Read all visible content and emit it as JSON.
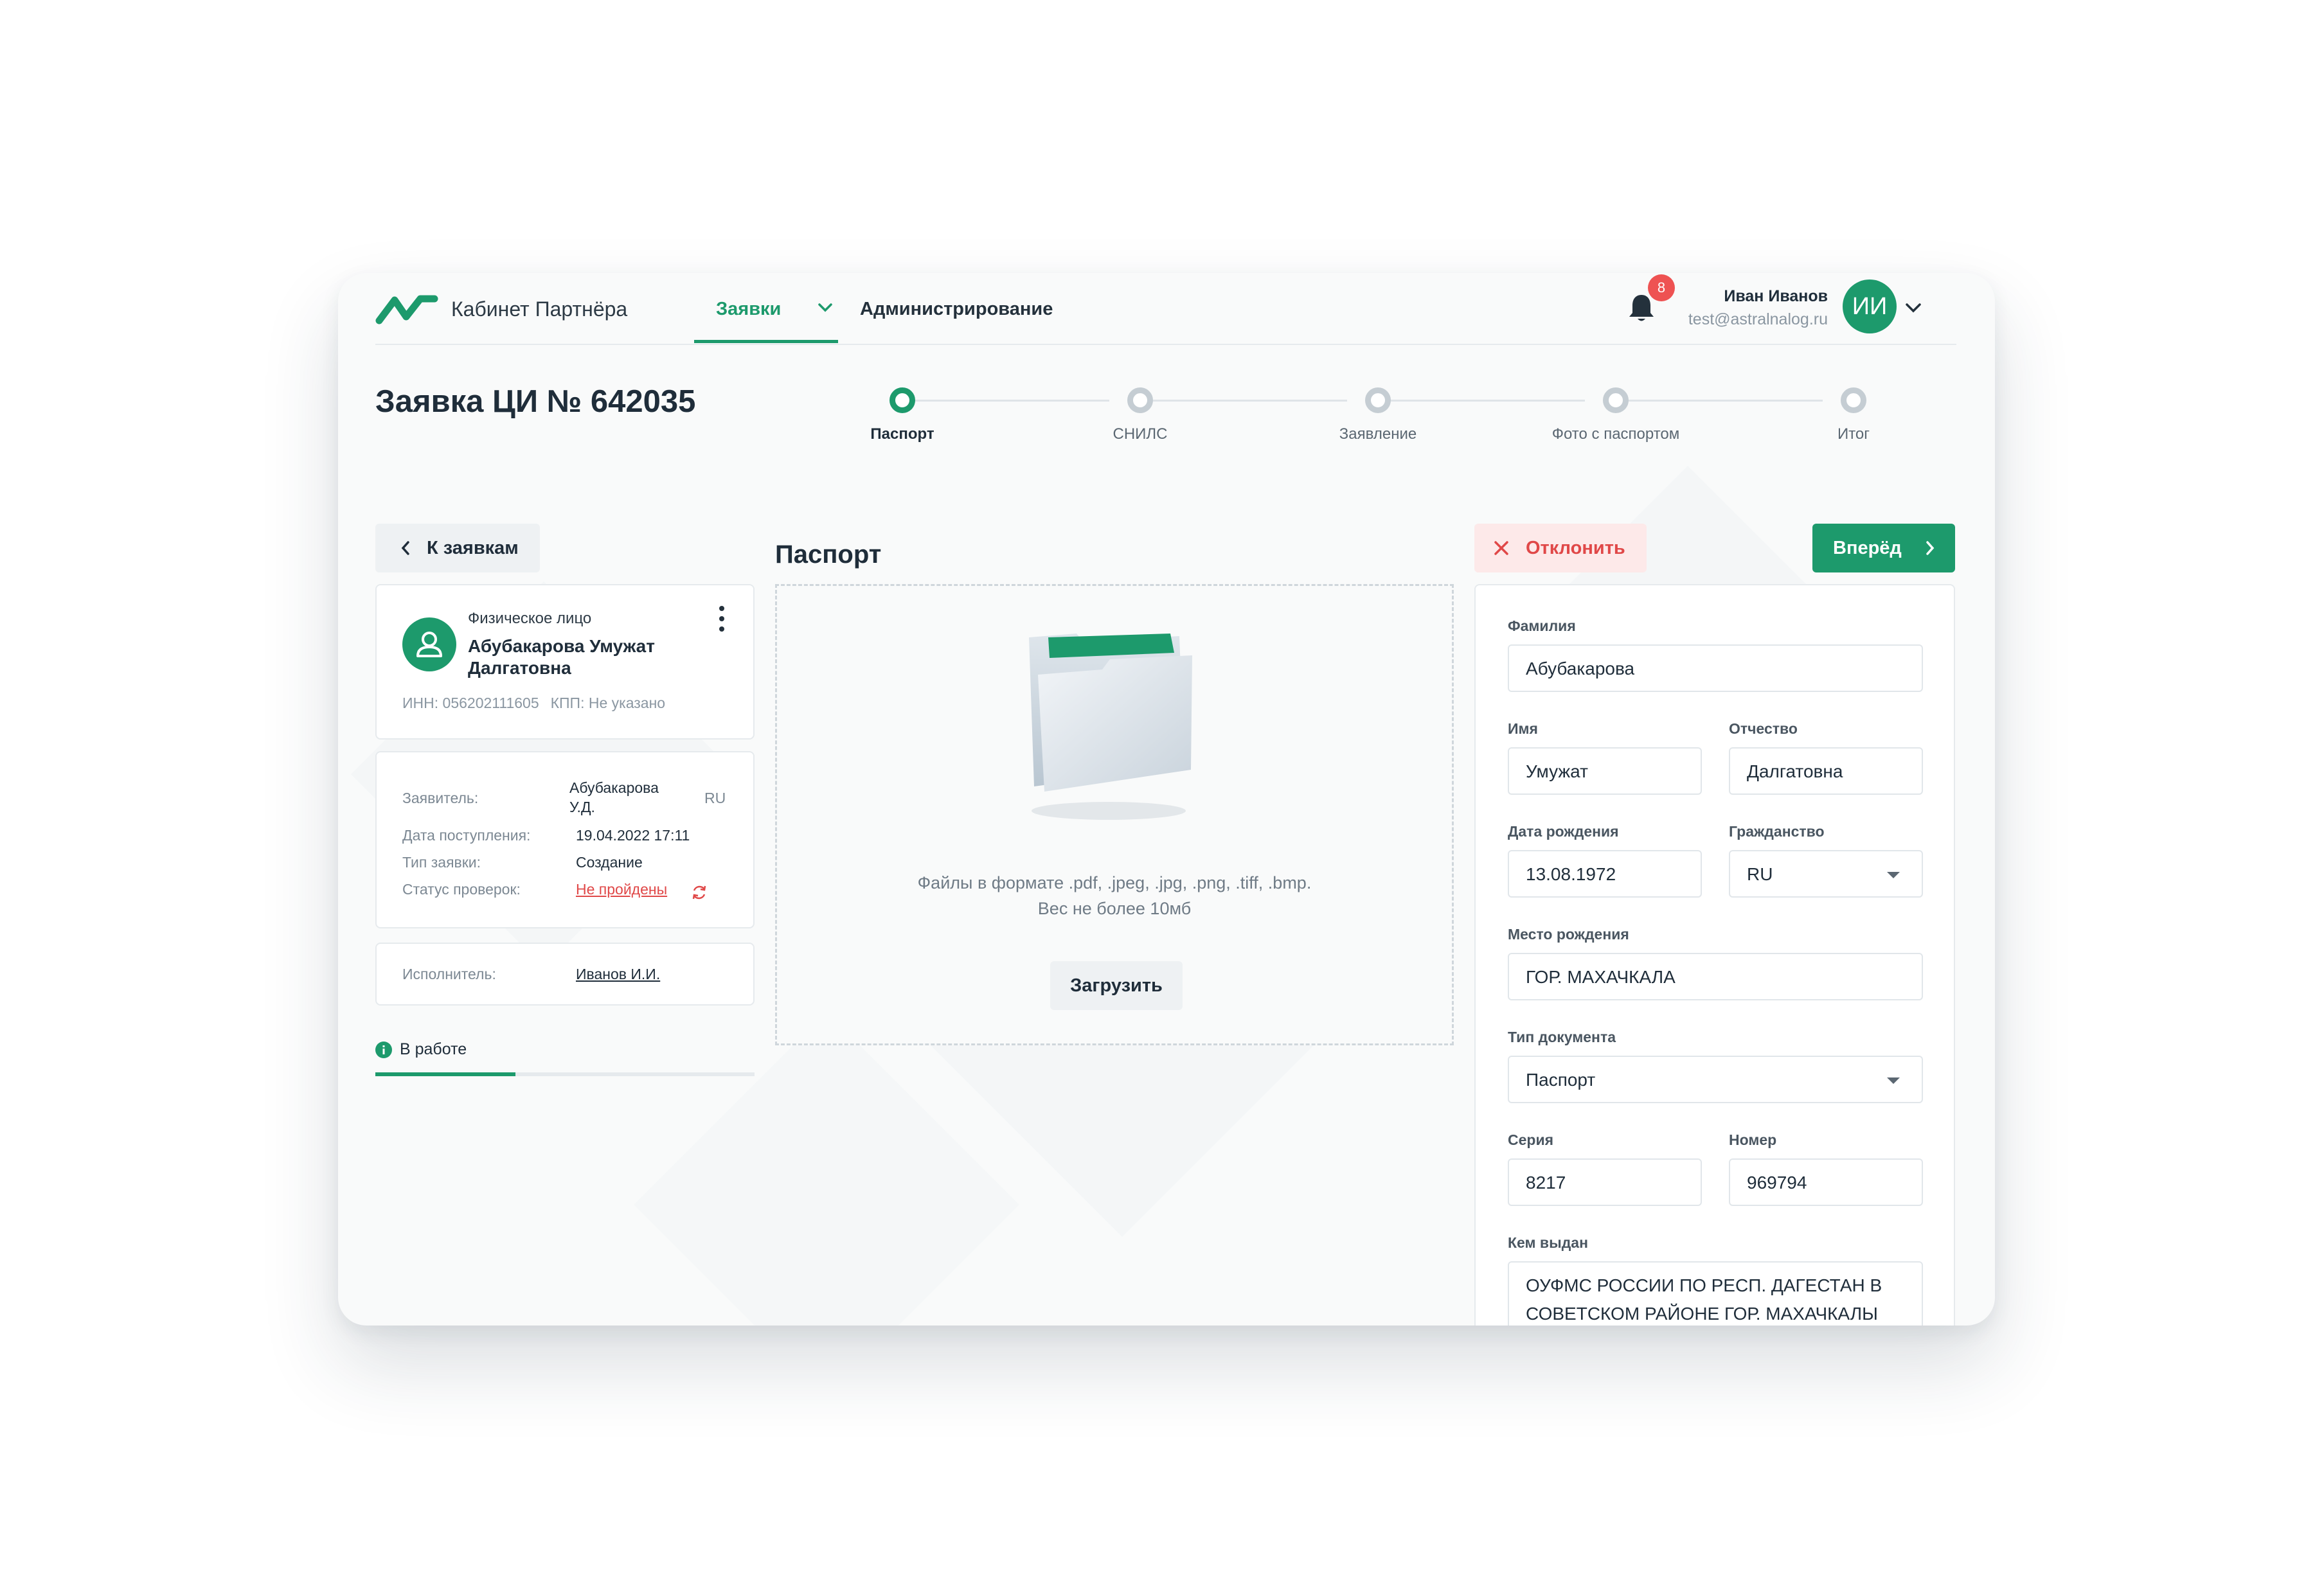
{
  "app": {
    "title": "Кабинет Партнёра"
  },
  "nav": {
    "tabs": [
      {
        "label": "Заявки",
        "active": true
      },
      {
        "label": "Администрирование",
        "active": false
      }
    ]
  },
  "notifications": {
    "count": "8"
  },
  "user": {
    "name": "Иван Иванов",
    "email": "test@astralnalog.ru",
    "initials": "ИИ"
  },
  "page": {
    "title": "Заявка ЦИ № 642035"
  },
  "steps": [
    {
      "label": "Паспорт",
      "active": true
    },
    {
      "label": "СНИЛС",
      "active": false
    },
    {
      "label": "Заявление",
      "active": false
    },
    {
      "label": "Фото с паспортом",
      "active": false
    },
    {
      "label": "Итог",
      "active": false
    }
  ],
  "back_button": {
    "label": "К заявкам"
  },
  "applicant_card": {
    "type": "Физическое лицо",
    "name": "Абубакарова Умужат Далгатовна",
    "inn": "ИНН: 056202111605",
    "kpp": "КПП: Не указано"
  },
  "info": {
    "applicant_label": "Заявитель:",
    "applicant_value": "Абубакарова У.Д.",
    "applicant_country": "RU",
    "received_label": "Дата поступления:",
    "received_value": "19.04.2022 17:11",
    "type_label": "Тип заявки:",
    "type_value": "Создание",
    "status_label": "Статус проверок:",
    "status_value": "Не пройдены"
  },
  "executor": {
    "label": "Исполнитель:",
    "value": "Иванов И.И."
  },
  "work_status": {
    "label": "В работе",
    "progress": 0.37
  },
  "upload": {
    "title": "Паспорт",
    "hint_line1": "Файлы в формате .pdf, .jpeg, .jpg, .png, .tiff, .bmp.",
    "hint_line2": "Вес не более 10мб",
    "button": "Загрузить"
  },
  "actions": {
    "reject": "Отклонить",
    "next": "Вперёд"
  },
  "form": {
    "surname": {
      "label": "Фамилия",
      "value": "Абубакарова"
    },
    "name": {
      "label": "Имя",
      "value": "Умужат"
    },
    "patronymic": {
      "label": "Отчество",
      "value": "Далгатовна"
    },
    "birth_date": {
      "label": "Дата рождения",
      "value": "13.08.1972"
    },
    "citizenship": {
      "label": "Гражданство",
      "value": "RU"
    },
    "birth_place": {
      "label": "Место рождения",
      "value": "ГОР. МАХАЧКАЛА"
    },
    "doc_type": {
      "label": "Тип документа",
      "value": "Паспорт"
    },
    "series": {
      "label": "Серия",
      "value": "8217"
    },
    "number": {
      "label": "Номер",
      "value": "969794"
    },
    "issued_by": {
      "label": "Кем выдан",
      "value": "ОУФМС РОССИИ ПО РЕСП. ДАГЕСТАН В СОВЕТСКОМ РАЙОНЕ ГОР. МАХАЧКАЛЫ"
    }
  },
  "colors": {
    "accent": "#1d9a6c",
    "danger": "#e04848",
    "muted": "#8a96a1"
  }
}
